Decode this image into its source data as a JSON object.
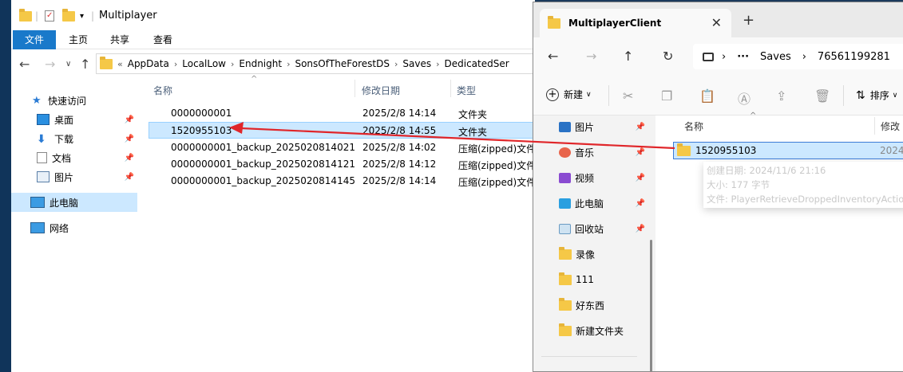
{
  "left_window": {
    "title": "Multiplayer",
    "menu": [
      "文件",
      "主页",
      "共享",
      "查看"
    ],
    "breadcrumb": [
      "AppData",
      "LocalLow",
      "Endnight",
      "SonsOfTheForestDS",
      "Saves",
      "DedicatedSer"
    ],
    "breadcrumb_overflow": "«",
    "nav": {
      "quick_access": "快速访问",
      "desktop": "桌面",
      "downloads": "下载",
      "documents": "文档",
      "pictures": "图片",
      "this_pc": "此电脑",
      "network": "网络"
    },
    "columns": {
      "name": "名称",
      "date": "修改日期",
      "type": "类型"
    },
    "files": [
      {
        "name": "0000000001",
        "date": "2025/2/8 14:14",
        "type": "文件夹"
      },
      {
        "name": "1520955103",
        "date": "2025/2/8 14:55",
        "type": "文件夹"
      },
      {
        "name": "0000000001_backup_2025020814021...",
        "date": "2025/2/8 14:02",
        "type": "压缩(zipped)文件"
      },
      {
        "name": "0000000001_backup_2025020814121...",
        "date": "2025/2/8 14:12",
        "type": "压缩(zipped)文件"
      },
      {
        "name": "0000000001_backup_2025020814145...",
        "date": "2025/2/8 14:14",
        "type": "压缩(zipped)文件"
      }
    ]
  },
  "right_window": {
    "tab_title": "MultiplayerClient",
    "breadcrumb": [
      "Saves",
      "76561199281"
    ],
    "toolbar": {
      "new_label": "新建",
      "sort_label": "排序"
    },
    "sidebar": [
      "图片",
      "音乐",
      "视频",
      "此电脑",
      "回收站",
      "录像",
      "111",
      "好东西",
      "新建文件夹"
    ],
    "columns": {
      "name": "名称",
      "date": "修改"
    },
    "file": {
      "name": "1520955103",
      "date": "2024"
    },
    "tooltip": {
      "created": "创建日期: 2024/11/6 21:16",
      "size": "大小: 177 字节",
      "files": "文件: PlayerRetrieveDroppedInventoryActio"
    }
  },
  "colors": {
    "accent": "#1979ca",
    "selection": "#cce8ff",
    "arrow": "#e0262a",
    "folder": "#f5c847"
  }
}
